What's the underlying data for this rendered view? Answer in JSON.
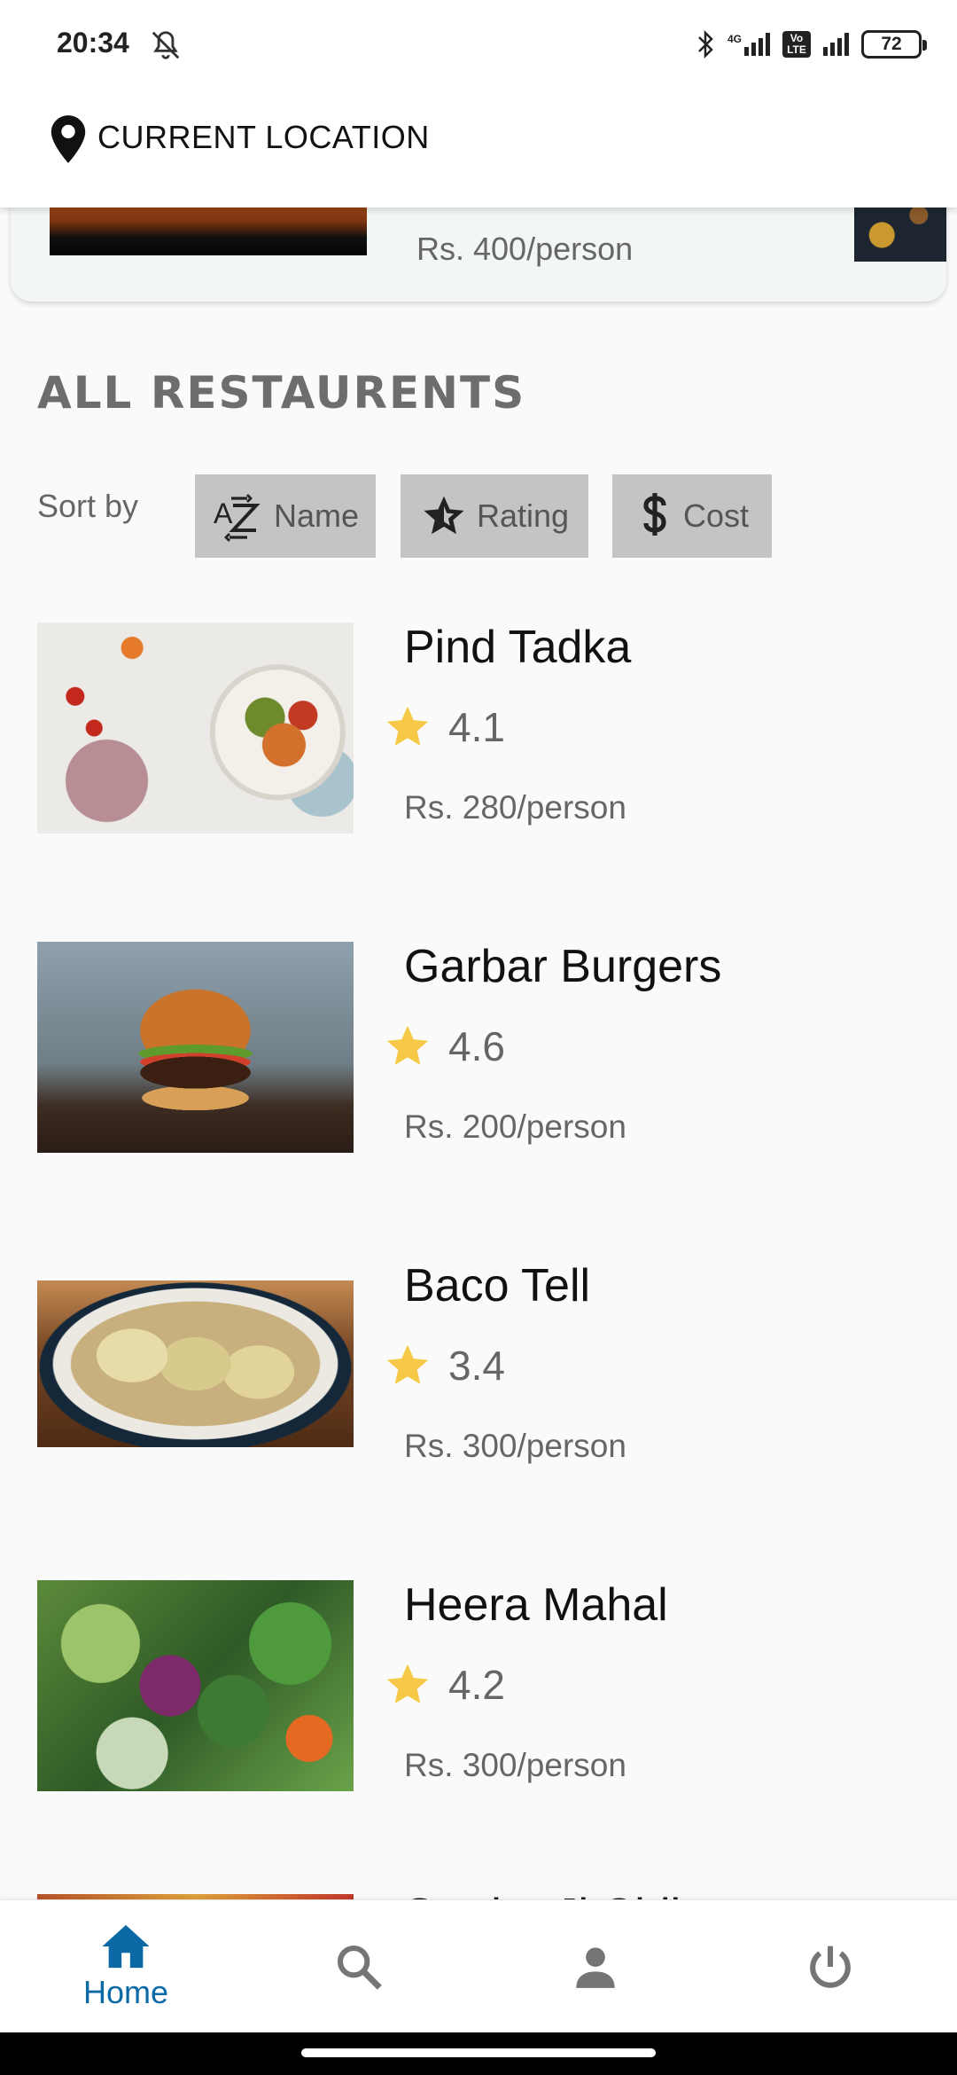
{
  "status_bar": {
    "time": "20:34",
    "network_1": "4G",
    "volte_label": "Vo LTE",
    "battery": "72"
  },
  "header": {
    "location_label": "CURRENT LOCATION",
    "location_icon": "location-pin-icon"
  },
  "featured": {
    "cost": "Rs. 400/person"
  },
  "section": {
    "title": "ALL RESTAURENTS"
  },
  "sort": {
    "label": "Sort by",
    "options": [
      {
        "icon": "sort-az-icon",
        "label": "Name"
      },
      {
        "icon": "star-icon",
        "label": "Rating"
      },
      {
        "icon": "dollar-icon",
        "label": "Cost"
      }
    ]
  },
  "restaurants": [
    {
      "name": "Pind Tadka",
      "rating": "4.1",
      "cost": "Rs. 280/person"
    },
    {
      "name": "Garbar Burgers",
      "rating": "4.6",
      "cost": "Rs. 200/person"
    },
    {
      "name": "Baco Tell",
      "rating": "3.4",
      "cost": "Rs. 300/person"
    },
    {
      "name": "Heera Mahal",
      "rating": "4.2",
      "cost": "Rs. 300/person"
    },
    {
      "name": "Sardar Ji Chikan",
      "rating": "",
      "cost": ""
    }
  ],
  "bottom_nav": {
    "items": [
      {
        "label": "Home",
        "icon": "home-icon",
        "active": true
      },
      {
        "label": "",
        "icon": "search-icon",
        "active": false
      },
      {
        "label": "",
        "icon": "person-icon",
        "active": false
      },
      {
        "label": "",
        "icon": "power-icon",
        "active": false
      }
    ]
  },
  "colors": {
    "accent": "#0b6aa5",
    "star": "#f7c948",
    "sort_button_bg": "#c4c4c6"
  }
}
